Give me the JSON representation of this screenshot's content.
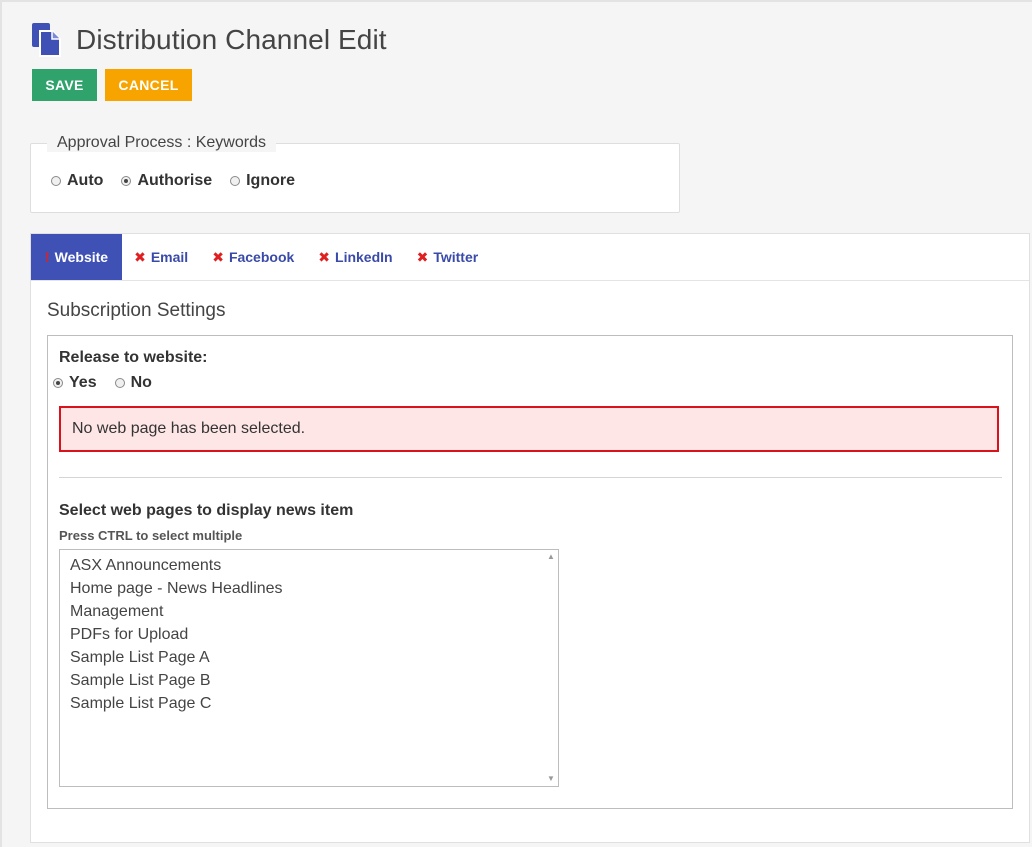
{
  "header": {
    "title": "Distribution Channel Edit",
    "icon": "document-copy-icon"
  },
  "toolbar": {
    "save_label": "SAVE",
    "cancel_label": "CANCEL"
  },
  "approval": {
    "legend": "Approval Process : Keywords",
    "options": [
      {
        "label": "Auto",
        "checked": false
      },
      {
        "label": "Authorise",
        "checked": true
      },
      {
        "label": "Ignore",
        "checked": false
      }
    ]
  },
  "tabs": [
    {
      "label": "Website",
      "active": true,
      "icon": "exclamation-icon"
    },
    {
      "label": "Email",
      "active": false,
      "icon": "x-icon"
    },
    {
      "label": "Facebook",
      "active": false,
      "icon": "x-icon"
    },
    {
      "label": "LinkedIn",
      "active": false,
      "icon": "x-icon"
    },
    {
      "label": "Twitter",
      "active": false,
      "icon": "x-icon"
    }
  ],
  "subscription": {
    "title": "Subscription Settings",
    "release_label": "Release to website:",
    "release_options": [
      {
        "label": "Yes",
        "checked": true
      },
      {
        "label": "No",
        "checked": false
      }
    ],
    "alert": "No web page has been selected.",
    "select_label": "Select web pages to display news item",
    "hint": "Press CTRL to select multiple",
    "pages": [
      "ASX Announcements",
      "Home page - News Headlines",
      "Management",
      "PDFs for Upload",
      "Sample List Page A",
      "Sample List Page B",
      "Sample List Page C"
    ]
  },
  "colors": {
    "save": "#2fa36b",
    "cancel": "#f7a400",
    "active_tab": "#3f51b5",
    "tab_link": "#3a4aa8",
    "alert_border": "#d9121b",
    "alert_bg": "#ffe6e6"
  }
}
